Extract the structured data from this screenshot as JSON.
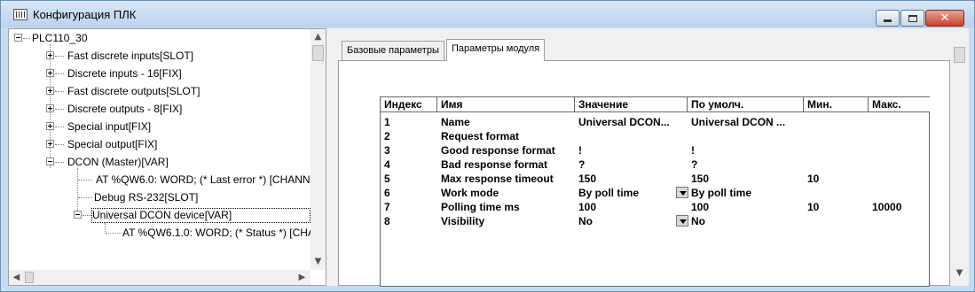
{
  "window": {
    "title": "Конфигурация ПЛК"
  },
  "tree": {
    "root": "PLC110_30",
    "items": [
      "Fast discrete inputs[SLOT]",
      "Discrete inputs - 16[FIX]",
      "Fast discrete outputs[SLOT]",
      "Discrete outputs - 8[FIX]",
      "Special input[FIX]",
      "Special output[FIX]",
      "DCON (Master)[VAR]",
      "AT %QW6.0: WORD; (* Last error *) [CHANN",
      "Debug RS-232[SLOT]",
      "Universal DCON device[VAR]",
      "AT %QW6.1.0: WORD; (* Status *) [CHA"
    ]
  },
  "tabs": [
    "Базовые параметры",
    "Параметры модуля"
  ],
  "grid": {
    "columns": [
      "Индекс",
      "Имя",
      "Значение",
      "По умолч.",
      "Мин.",
      "Макс."
    ],
    "rows": [
      [
        "1",
        "Name",
        "Universal DCON...",
        "Universal DCON ...",
        "",
        ""
      ],
      [
        "2",
        "Request format",
        "",
        "",
        "",
        ""
      ],
      [
        "3",
        "Good response format",
        "!",
        "!",
        "",
        ""
      ],
      [
        "4",
        "Bad response format",
        "?",
        "?",
        "",
        ""
      ],
      [
        "5",
        "Max response timeout",
        "150",
        "150",
        "10",
        ""
      ],
      [
        "6",
        "Work mode",
        "By poll time",
        "By poll time",
        "",
        ""
      ],
      [
        "7",
        "Polling time ms",
        "100",
        "100",
        "10",
        "10000"
      ],
      [
        "8",
        "Visibility",
        "No",
        "No",
        "",
        ""
      ]
    ]
  }
}
